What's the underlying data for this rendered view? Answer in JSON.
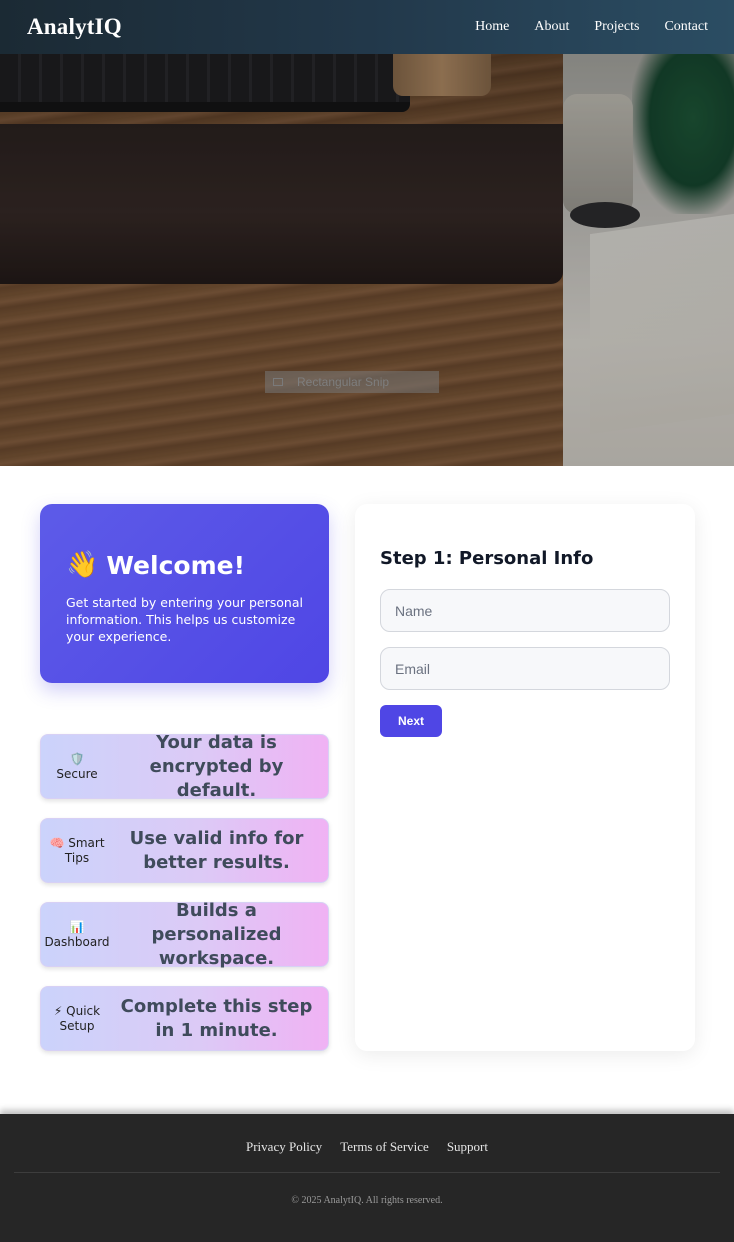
{
  "header": {
    "brand": "AnalytIQ",
    "nav": [
      "Home",
      "About",
      "Projects",
      "Contact"
    ]
  },
  "hero": {
    "tooltip": "Rectangular Snip"
  },
  "welcome": {
    "icon": "👋",
    "title": "Welcome!",
    "description": "Get started by entering your personal information. This helps us customize your experience."
  },
  "features": [
    {
      "icon": "🛡️",
      "label": "Secure",
      "text": "Your data is encrypted by default."
    },
    {
      "icon": "🧠",
      "label": "Smart Tips",
      "text": "Use valid info for better results."
    },
    {
      "icon": "📊",
      "label": "Dashboard",
      "text": "Builds a personalized workspace."
    },
    {
      "icon": "⚡",
      "label": "Quick Setup",
      "text": "Complete this step in 1 minute."
    }
  ],
  "form": {
    "title": "Step 1: Personal Info",
    "name_placeholder": "Name",
    "email_placeholder": "Email",
    "next_label": "Next"
  },
  "footer": {
    "links": [
      "Privacy Policy",
      "Terms of Service",
      "Support"
    ],
    "copyright": "© 2025 AnalytIQ. All rights reserved."
  },
  "colors": {
    "accent": "#4f46e5",
    "header_bg": "#22384a",
    "footer_bg": "#262626"
  }
}
